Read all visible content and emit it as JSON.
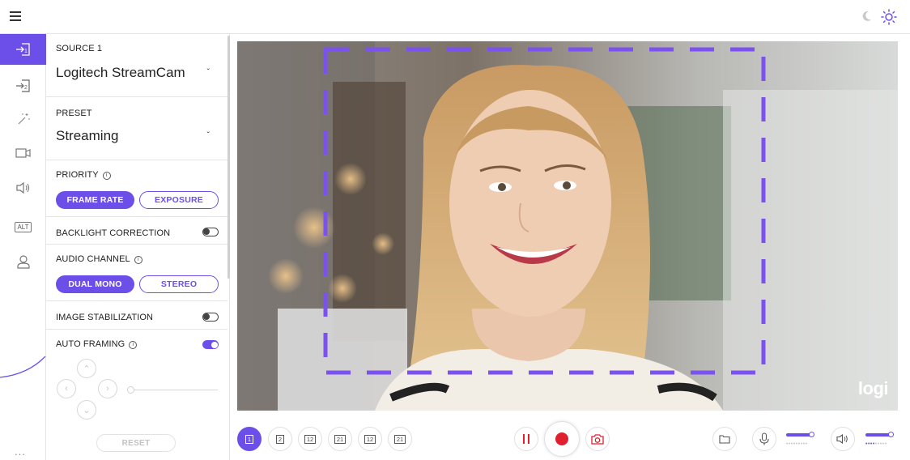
{
  "accent_color": "#6c4fe8",
  "topbar": {
    "menu_icon": "hamburger-menu-icon",
    "theme_icons": [
      "moon-icon",
      "sun-icon"
    ]
  },
  "rail": {
    "items": [
      {
        "icon": "source-1-icon",
        "active": true
      },
      {
        "icon": "source-2-icon",
        "active": false
      },
      {
        "icon": "effects-wand-icon",
        "active": false
      },
      {
        "icon": "camera-icon",
        "active": false
      },
      {
        "icon": "speaker-icon",
        "active": false
      },
      {
        "icon": "alt-icon",
        "label": "ALT",
        "active": false
      },
      {
        "icon": "user-icon",
        "active": false
      }
    ],
    "more": "..."
  },
  "panel": {
    "source_label": "SOURCE 1",
    "source_value": "Logitech StreamCam",
    "preset_label": "PRESET",
    "preset_value": "Streaming",
    "priority_label": "PRIORITY",
    "priority_options": [
      "FRAME RATE",
      "EXPOSURE"
    ],
    "priority_selected": "FRAME RATE",
    "backlight_label": "BACKLIGHT CORRECTION",
    "backlight_on": false,
    "audio_label": "AUDIO CHANNEL",
    "audio_options": [
      "DUAL MONO",
      "STEREO"
    ],
    "audio_selected": "DUAL MONO",
    "stabilization_label": "IMAGE STABILIZATION",
    "stabilization_on": false,
    "autoframing_label": "AUTO FRAMING",
    "autoframing_on": true,
    "reset_label": "RESET"
  },
  "preview": {
    "watermark": "logi"
  },
  "toolbar": {
    "layouts": [
      "1",
      "2",
      "12",
      "21",
      "12",
      "21"
    ],
    "active_layout": 0,
    "volume_mic": 0.6,
    "volume_speaker": 0.6
  }
}
